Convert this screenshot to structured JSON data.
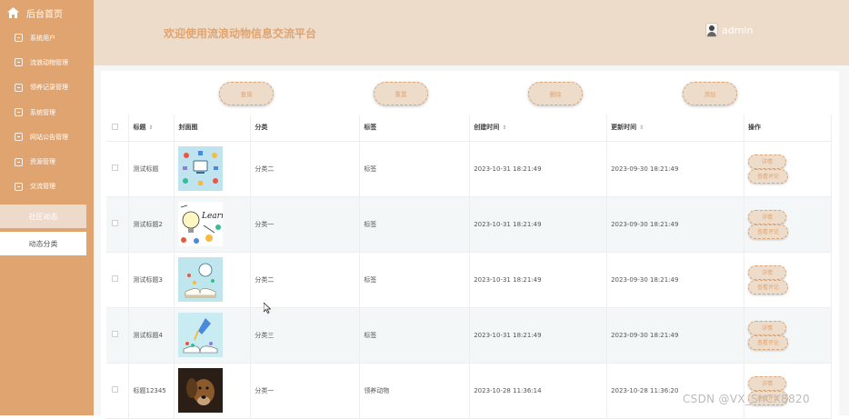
{
  "sidebar": {
    "home_label": "后台首页",
    "items": [
      {
        "label": "系统用户",
        "icon": "plus-square-icon"
      },
      {
        "label": "流浪动物管理",
        "icon": "check-square-icon"
      },
      {
        "label": "领养记录管理",
        "icon": "shield-icon"
      },
      {
        "label": "系统管理",
        "icon": "edit-icon"
      },
      {
        "label": "网站公告管理",
        "icon": "document-icon"
      },
      {
        "label": "资源管理",
        "icon": "edit-icon"
      },
      {
        "label": "交流管理",
        "icon": "shield-icon"
      }
    ],
    "active_sub": "社区动态",
    "sub_item": "动态分类"
  },
  "header": {
    "title": "欢迎使用流浪动物信息交流平台",
    "username": "admin"
  },
  "toolbar": {
    "search": "查询",
    "reset": "重置",
    "delete": "删除",
    "add": "添加"
  },
  "table": {
    "columns": [
      "标题",
      "封面图",
      "分类",
      "标签",
      "创建时间",
      "更新时间",
      "操作"
    ],
    "rows": [
      {
        "title": "测试标题",
        "cover": "infographic-image",
        "category": "分类二",
        "tag": "标签",
        "created": "2023-10-31 18:21:49",
        "updated": "2023-09-30 18:21:49"
      },
      {
        "title": "测试标题2",
        "cover": "learn-doodle-image",
        "category": "分类一",
        "tag": "标签",
        "created": "2023-10-31 18:21:49",
        "updated": "2023-09-30 18:21:49"
      },
      {
        "title": "测试标题3",
        "cover": "open-book-lightbulb-image",
        "category": "分类二",
        "tag": "标签",
        "created": "2023-10-31 18:21:49",
        "updated": "2023-09-30 18:21:49"
      },
      {
        "title": "测试标题4",
        "cover": "book-rocket-image",
        "category": "分类三",
        "tag": "标签",
        "created": "2023-10-31 18:21:49",
        "updated": "2023-09-30 18:21:49"
      },
      {
        "title": "标题12345",
        "cover": "dog-photo",
        "category": "分类一",
        "tag": "领养动物",
        "created": "2023-10-28 11:36:14",
        "updated": "2023-10-28 11:36:20"
      }
    ],
    "action_detail": "详情",
    "action_comments": "查看评论"
  },
  "watermark": "CSDN @VX_ShCX8820",
  "colors": {
    "sidebar": "#e0a470",
    "header": "#eedcca",
    "accent": "#e0a470"
  }
}
